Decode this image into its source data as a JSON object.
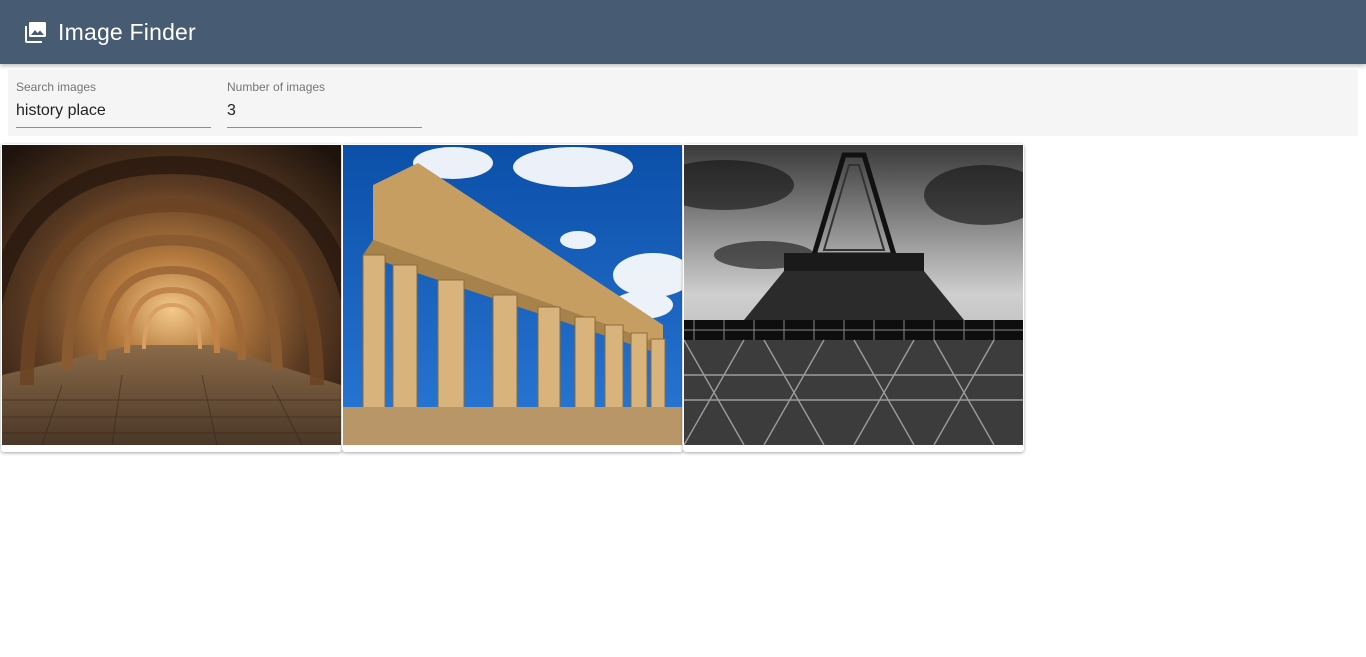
{
  "app": {
    "title": "Image Finder",
    "icon": "image-icon",
    "header_color": "#475b73"
  },
  "search": {
    "query_label": "Search images",
    "query_value": "history place",
    "count_label": "Number of images",
    "count_value": "3"
  },
  "results": [
    {
      "subject": "stone arched tunnel",
      "icon": "image-tile"
    },
    {
      "subject": "ancient greek temple columns",
      "icon": "image-tile"
    },
    {
      "subject": "eiffel tower black and white",
      "icon": "image-tile"
    }
  ]
}
